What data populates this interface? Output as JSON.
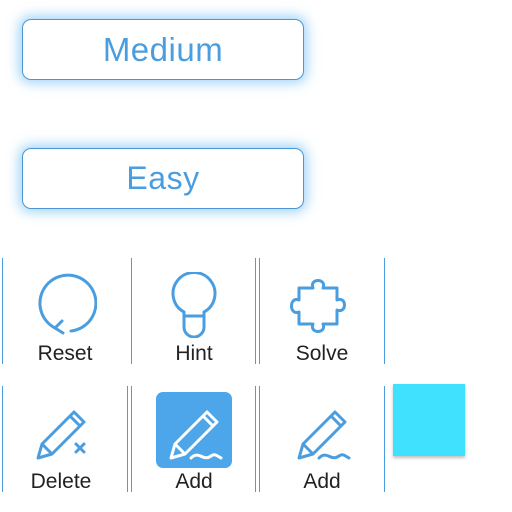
{
  "difficulty": {
    "medium_label": "Medium",
    "easy_label": "Easy"
  },
  "tools_row1": [
    {
      "label": "Reset",
      "icon": "reset-icon"
    },
    {
      "label": "Hint",
      "icon": "lightbulb-icon"
    },
    {
      "label": "Solve",
      "icon": "puzzle-icon"
    }
  ],
  "tools_row2": [
    {
      "label": "Delete",
      "icon": "pencil-delete-icon"
    },
    {
      "label": "Add",
      "icon": "pencil-add-icon",
      "selected": true
    },
    {
      "label": "Add",
      "icon": "pencil-add-icon"
    }
  ],
  "colors": {
    "accent": "#4a9ee0",
    "selected_tile": "#4ea6ea",
    "swatch": "#40e0ff"
  }
}
